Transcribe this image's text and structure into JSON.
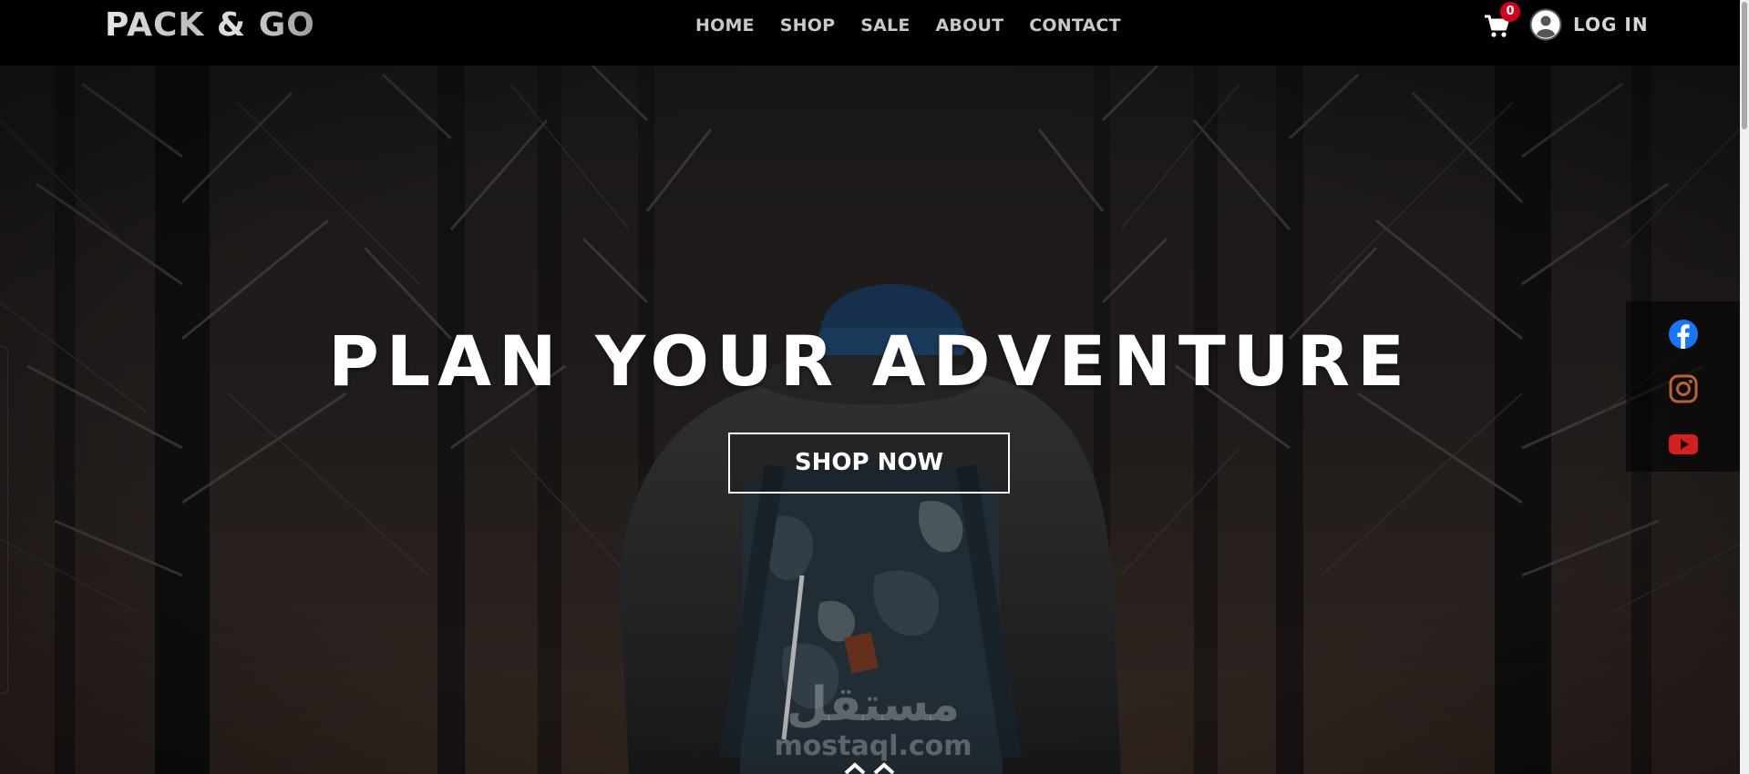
{
  "brand": {
    "name": "PACK & GO"
  },
  "nav": {
    "links": [
      {
        "label": "HOME"
      },
      {
        "label": "SHOP"
      },
      {
        "label": "SALE"
      },
      {
        "label": "ABOUT"
      },
      {
        "label": "CONTACT"
      }
    ]
  },
  "cart": {
    "count": "0",
    "icon": "cart-icon"
  },
  "account": {
    "login_label": "LOG IN",
    "icon": "user-circle-icon"
  },
  "hero": {
    "title": "PLAN YOUR ADVENTURE",
    "cta_label": "SHOP NOW"
  },
  "social": {
    "items": [
      {
        "name": "facebook",
        "icon": "facebook-icon",
        "color": "#1877f2"
      },
      {
        "name": "instagram",
        "icon": "instagram-icon",
        "color": "#b8623a"
      },
      {
        "name": "youtube",
        "icon": "youtube-icon",
        "color": "#d21f1f"
      }
    ]
  },
  "watermark": {
    "arabic": "مستقل",
    "latin": "mostaql.com"
  },
  "colors": {
    "navbar_bg": "#000000",
    "badge": "#d0021b",
    "hero_text": "#ffffff"
  }
}
